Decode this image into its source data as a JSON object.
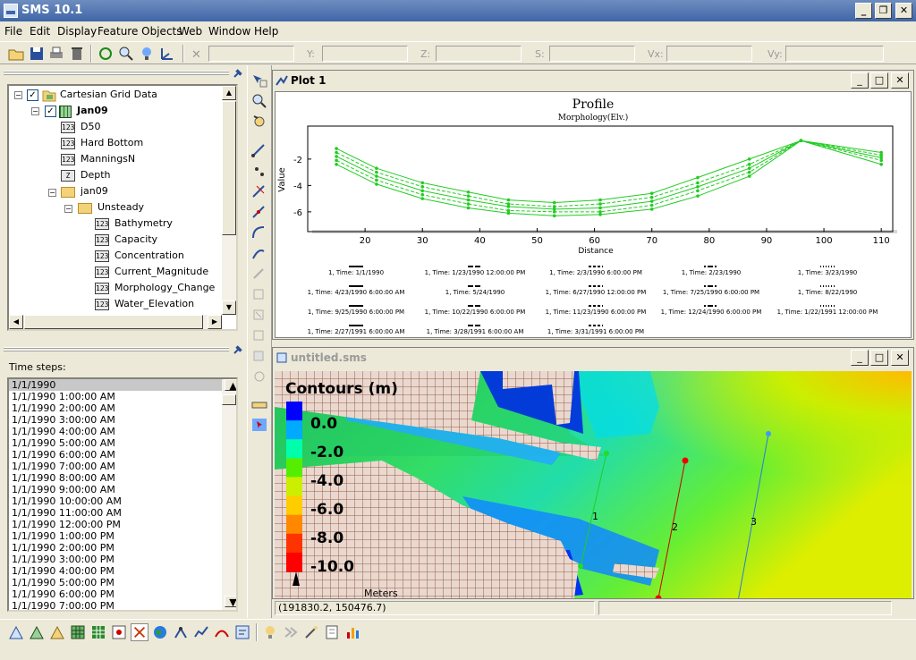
{
  "app": {
    "title": "SMS 10.1"
  },
  "menu": [
    "File",
    "Edit",
    "Display",
    "Feature Objects",
    "Web",
    "Window",
    "Help"
  ],
  "coords": {
    "x_label": "X:",
    "y_label": "Y:",
    "z_label": "Z:",
    "s_label": "S:",
    "vx_label": "Vx:",
    "vy_label": "Vy:"
  },
  "tree": {
    "root": "Cartesian Grid Data",
    "grid": "Jan09",
    "datasets": [
      "D50",
      "Hard Bottom",
      "ManningsN",
      "Depth"
    ],
    "folder1": "jan09",
    "folder2": "Unsteady",
    "unsteady": [
      "Bathymetry",
      "Capacity",
      "Concentration",
      "Current_Magnitude",
      "Morphology_Change",
      "Water_Elevation"
    ]
  },
  "timesteps": {
    "label": "Time steps:",
    "items": [
      "1/1/1990",
      "1/1/1990 1:00:00 AM",
      "1/1/1990 2:00:00 AM",
      "1/1/1990 3:00:00 AM",
      "1/1/1990 4:00:00 AM",
      "1/1/1990 5:00:00 AM",
      "1/1/1990 6:00:00 AM",
      "1/1/1990 7:00:00 AM",
      "1/1/1990 8:00:00 AM",
      "1/1/1990 9:00:00 AM",
      "1/1/1990 10:00:00 AM",
      "1/1/1990 11:00:00 AM",
      "1/1/1990 12:00:00 PM",
      "1/1/1990 1:00:00 PM",
      "1/1/1990 2:00:00 PM",
      "1/1/1990 3:00:00 PM",
      "1/1/1990 4:00:00 PM",
      "1/1/1990 5:00:00 PM",
      "1/1/1990 6:00:00 PM",
      "1/1/1990 7:00:00 PM"
    ]
  },
  "plot": {
    "window_title": "Plot 1",
    "legend_label_prefix": "1, Time: ",
    "legend_times": [
      "1/1/1990",
      "1/23/1990 12:00:00 PM",
      "2/3/1990 6:00:00 PM",
      "2/23/1990",
      "3/23/1990",
      "4/23/1990 6:00:00 AM",
      "5/24/1990",
      "6/27/1990 12:00:00 PM",
      "7/25/1990 6:00:00 PM",
      "8/22/1990",
      "9/25/1990 6:00:00 PM",
      "10/22/1990 6:00:00 PM",
      "11/23/1990 6:00:00 PM",
      "12/24/1990 6:00:00 PM",
      "1/22/1991 12:00:00 PM",
      "2/27/1991 6:00:00 AM",
      "3/28/1991 6:00:00 AM",
      "3/31/1991 6:00:00 PM"
    ]
  },
  "chart_data": {
    "type": "line",
    "title": "Profile",
    "subtitle": "Morphology(Elv.)",
    "xlabel": "Distance",
    "ylabel": "Value",
    "xlim": [
      10,
      112
    ],
    "ylim": [
      -7.5,
      0.5
    ],
    "xticks": [
      20,
      30,
      40,
      50,
      60,
      70,
      80,
      90,
      100,
      110
    ],
    "yticks": [
      -2,
      -4,
      -6
    ],
    "line_color": "#22cc22",
    "x": [
      15,
      22,
      30,
      38,
      45,
      53,
      61,
      70,
      78,
      87,
      96,
      110
    ],
    "series": [
      {
        "values": [
          -1.2,
          -2.7,
          -3.8,
          -4.5,
          -5.1,
          -5.3,
          -5.1,
          -4.6,
          -3.4,
          -2.0,
          -0.6,
          -1.5
        ]
      },
      {
        "values": [
          -1.5,
          -3.0,
          -4.1,
          -4.8,
          -5.4,
          -5.6,
          -5.4,
          -4.9,
          -3.8,
          -2.4,
          -0.6,
          -1.7
        ]
      },
      {
        "values": [
          -1.8,
          -3.3,
          -4.4,
          -5.1,
          -5.6,
          -5.8,
          -5.7,
          -5.2,
          -4.1,
          -2.7,
          -0.6,
          -1.9
        ]
      },
      {
        "values": [
          -2.1,
          -3.6,
          -4.7,
          -5.4,
          -5.9,
          -6.0,
          -6.0,
          -5.5,
          -4.4,
          -3.0,
          -0.6,
          -2.1
        ]
      },
      {
        "values": [
          -2.4,
          -3.9,
          -5.0,
          -5.7,
          -6.1,
          -6.3,
          -6.2,
          -5.8,
          -4.8,
          -3.3,
          -0.6,
          -2.4
        ]
      }
    ]
  },
  "map": {
    "window_title": "untitled.sms",
    "legend_title": "Contours (m)",
    "legend_values": [
      "0.0",
      "-2.0",
      "-4.0",
      "-6.0",
      "-8.0",
      "-10.0"
    ],
    "legend_colors": [
      "#0000ff",
      "#00aaff",
      "#00ffaa",
      "#55ee00",
      "#ccee00",
      "#ffcc00",
      "#ff8800",
      "#ff3300",
      "#ff0000"
    ],
    "scale_label": "Meters",
    "transect_labels": [
      "1",
      "2",
      "3"
    ]
  },
  "status": {
    "coords": "(191830.2, 150476.7)"
  }
}
